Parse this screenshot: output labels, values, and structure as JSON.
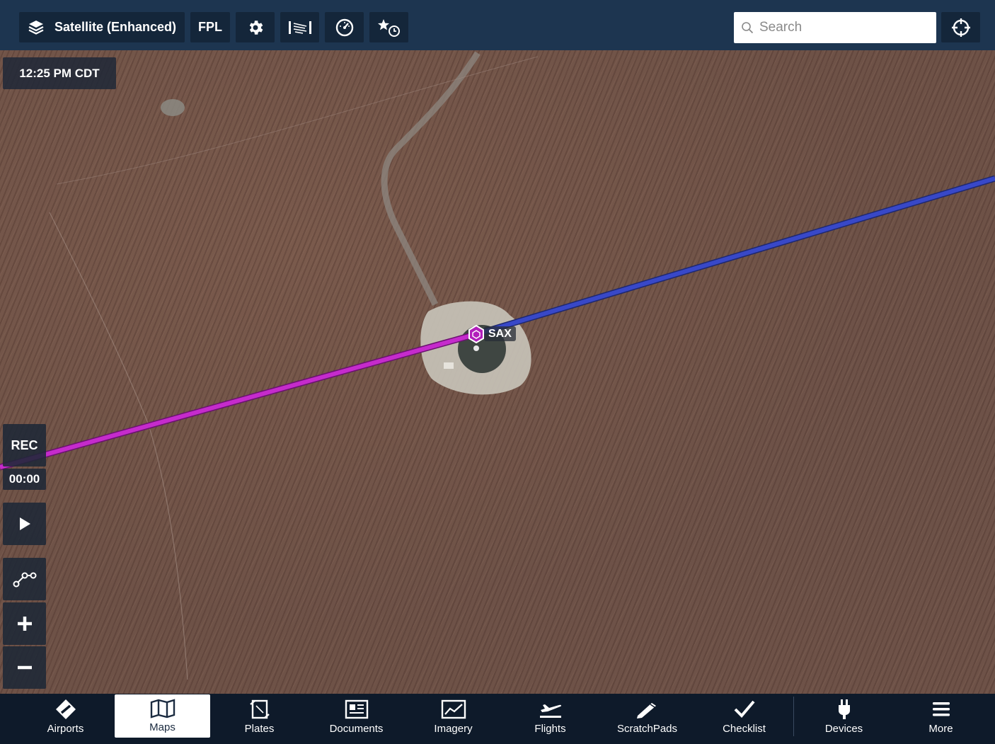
{
  "toolbar": {
    "layer_label": "Satellite (Enhanced)",
    "fpl_label": "FPL",
    "icons": [
      "layers-icon",
      "gear-icon",
      "wind-icon",
      "gauge-icon",
      "favorites-clock-icon"
    ],
    "search_placeholder": "Search",
    "locate_icon": "crosshair-icon"
  },
  "map": {
    "time": "12:25 PM CDT",
    "rec_label": "REC",
    "rec_timer": "00:00",
    "waypoint": "SAX",
    "route_colors": {
      "flown": "#c026c8",
      "upcoming": "#3545c8",
      "waypoint": "#b21fbb"
    }
  },
  "tabs": [
    {
      "label": "Airports",
      "icon": "airport-diamond-icon",
      "active": false
    },
    {
      "label": "Maps",
      "icon": "map-icon",
      "active": true
    },
    {
      "label": "Plates",
      "icon": "plates-icon",
      "active": false
    },
    {
      "label": "Documents",
      "icon": "documents-icon",
      "active": false
    },
    {
      "label": "Imagery",
      "icon": "imagery-icon",
      "active": false
    },
    {
      "label": "Flights",
      "icon": "plane-icon",
      "active": false
    },
    {
      "label": "ScratchPads",
      "icon": "pencil-icon",
      "active": false
    },
    {
      "label": "Checklist",
      "icon": "checkmark-icon",
      "active": false
    },
    {
      "label": "Devices",
      "icon": "plug-icon",
      "active": false
    },
    {
      "label": "More",
      "icon": "hamburger-icon",
      "active": false
    }
  ]
}
